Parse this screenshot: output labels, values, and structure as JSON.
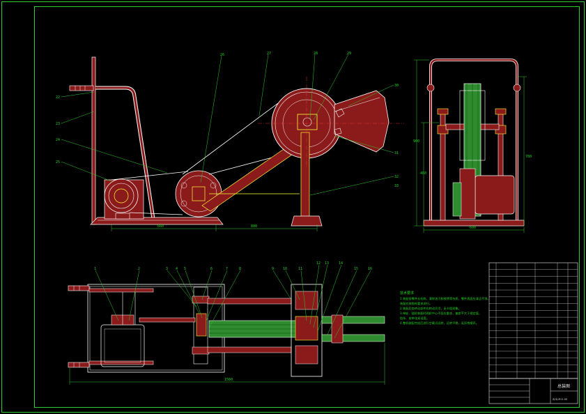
{
  "drawing": {
    "palette": {
      "background": "#000000",
      "frame": "#2ecc2e",
      "part": "#ffffff",
      "part_fill": "#8b1a1a",
      "accent": "#ffff3c",
      "gear_fill": "#2e8b2e",
      "leader": "#2ecc2e",
      "dimension": "#2ecc2e"
    },
    "front_view": {
      "callouts": [
        {
          "id": "fv-22a",
          "text": "22"
        },
        {
          "id": "fv-23",
          "text": "23"
        },
        {
          "id": "fv-24",
          "text": "24"
        },
        {
          "id": "fv-25",
          "text": "25"
        },
        {
          "id": "fv-26",
          "text": "26"
        },
        {
          "id": "fv-27",
          "text": "27"
        },
        {
          "id": "fv-28",
          "text": "28"
        },
        {
          "id": "fv-29",
          "text": "29"
        },
        {
          "id": "fv-30",
          "text": "30"
        },
        {
          "id": "fv-31",
          "text": "31"
        },
        {
          "id": "fv-32",
          "text": "32"
        },
        {
          "id": "fv-33",
          "text": "33"
        }
      ],
      "dimensions": {
        "left": "660",
        "right": "800"
      }
    },
    "side_view": {
      "dimensions": {
        "height_outer": "900",
        "height_inner": "460",
        "height_right": "780",
        "width": "600"
      }
    },
    "plan_view": {
      "callouts": [
        {
          "id": "pv-1",
          "text": "1"
        },
        {
          "id": "pv-2",
          "text": "2"
        },
        {
          "id": "pv-3",
          "text": "3"
        },
        {
          "id": "pv-4",
          "text": "4"
        },
        {
          "id": "pv-5",
          "text": "5"
        },
        {
          "id": "pv-6",
          "text": "6"
        },
        {
          "id": "pv-7",
          "text": "7"
        },
        {
          "id": "pv-8",
          "text": "8"
        },
        {
          "id": "pv-9",
          "text": "9"
        },
        {
          "id": "pv-10",
          "text": "10"
        },
        {
          "id": "pv-11",
          "text": "11"
        },
        {
          "id": "pv-12",
          "text": "12"
        },
        {
          "id": "pv-13",
          "text": "13"
        },
        {
          "id": "pv-14",
          "text": "14"
        },
        {
          "id": "pv-15",
          "text": "15"
        },
        {
          "id": "pv-16",
          "text": "16"
        }
      ],
      "dimensions": {
        "overall": "1560"
      }
    },
    "technical_notes": {
      "title": "技术要求",
      "lines": [
        "1.装配前零件去毛刺，清除油污和铁锈等杂质，零件表面应清洁干净。",
        "   装配应按图纸要求进行。",
        "2.装配后各转动部件应转动灵活，无卡阻现象。",
        "3.带轮、链轮装配时两轮中心平面应重合，偏差不大于规定值，",
        "   链条、皮带张紧适度。",
        "4.整机装配完成后进行空载试运转，运转平稳，无异常噪声。"
      ]
    },
    "title_block": {
      "parts_rows": 17,
      "sheet_title": "总装图",
      "drawing_no": "ZJ.SJ.ZH.1.00"
    }
  }
}
